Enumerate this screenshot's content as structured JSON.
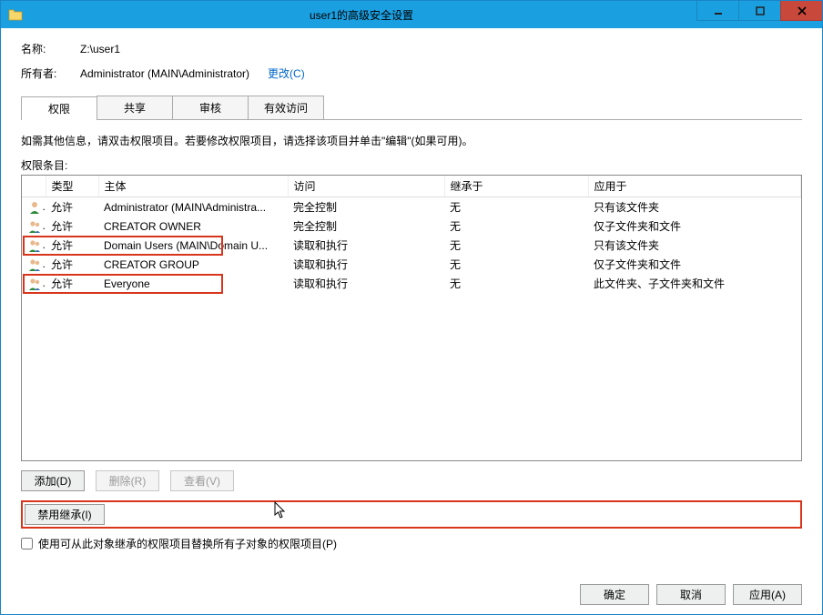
{
  "window": {
    "title": "user1的高级安全设置"
  },
  "header": {
    "name_label": "名称:",
    "name_value": "Z:\\user1",
    "owner_label": "所有者:",
    "owner_value": "Administrator (MAIN\\Administrator)",
    "change_link": "更改(C)"
  },
  "tabs": {
    "items": [
      {
        "label": "权限",
        "active": true
      },
      {
        "label": "共享",
        "active": false
      },
      {
        "label": "审核",
        "active": false
      },
      {
        "label": "有效访问",
        "active": false
      }
    ]
  },
  "body": {
    "instruction": "如需其他信息，请双击权限项目。若要修改权限项目，请选择该项目并单击\"编辑\"(如果可用)。",
    "entries_label": "权限条目:"
  },
  "grid": {
    "columns": {
      "type": "类型",
      "principal": "主体",
      "access": "访问",
      "inherited_from": "继承于",
      "applies_to": "应用于"
    },
    "rows": [
      {
        "icon": "user-single",
        "type": "允许",
        "principal": "Administrator (MAIN\\Administra...",
        "access": "完全控制",
        "inherited": "无",
        "applies": "只有该文件夹",
        "highlight": false
      },
      {
        "icon": "user-multi",
        "type": "允许",
        "principal": "CREATOR OWNER",
        "access": "完全控制",
        "inherited": "无",
        "applies": "仅子文件夹和文件",
        "highlight": false
      },
      {
        "icon": "user-multi",
        "type": "允许",
        "principal": "Domain Users (MAIN\\Domain U...",
        "access": "读取和执行",
        "inherited": "无",
        "applies": "只有该文件夹",
        "highlight": true
      },
      {
        "icon": "user-multi",
        "type": "允许",
        "principal": "CREATOR GROUP",
        "access": "读取和执行",
        "inherited": "无",
        "applies": "仅子文件夹和文件",
        "highlight": false
      },
      {
        "icon": "user-multi",
        "type": "允许",
        "principal": "Everyone",
        "access": "读取和执行",
        "inherited": "无",
        "applies": "此文件夹、子文件夹和文件",
        "highlight": true
      }
    ]
  },
  "buttons": {
    "add": "添加(D)",
    "remove": "删除(R)",
    "view": "查看(V)",
    "disable_inherit": "禁用继承(I)",
    "replace_label": "使用可从此对象继承的权限项目替换所有子对象的权限项目(P)",
    "ok": "确定",
    "cancel": "取消",
    "apply": "应用(A)"
  }
}
